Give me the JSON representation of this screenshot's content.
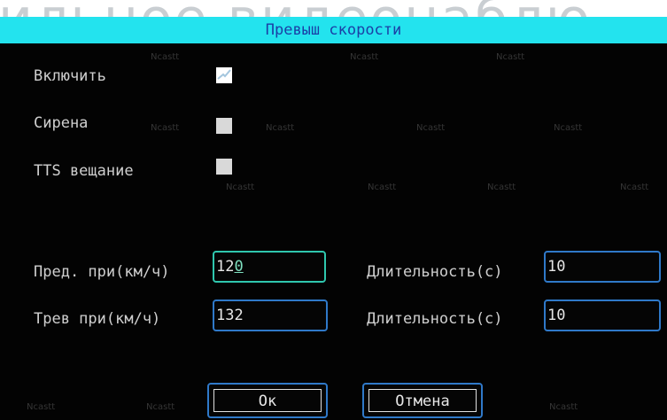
{
  "watermark": "ильное видеонаблю",
  "title": "Превыш скорости",
  "toggles": [
    {
      "label": "Включить",
      "checked": true
    },
    {
      "label": "Сирена",
      "checked": false
    },
    {
      "label": "TTS вещание",
      "checked": false
    }
  ],
  "rows": [
    {
      "label": "Пред. при(км/ч)",
      "value": "12",
      "value_tail": "0",
      "duration_label": "Длительность(с)",
      "duration_value": "10"
    },
    {
      "label": "Трев при(км/ч)",
      "value": "132",
      "duration_label": "Длительность(с)",
      "duration_value": "10"
    }
  ],
  "buttons": {
    "ok": "Ок",
    "cancel": "Отмена"
  },
  "background_mark": "Ncastt",
  "colors": {
    "title_strip": "#23e3ee",
    "title_text": "#1b3fa6",
    "field_border": "#2f79c9",
    "active_border": "#2fc7ae"
  }
}
